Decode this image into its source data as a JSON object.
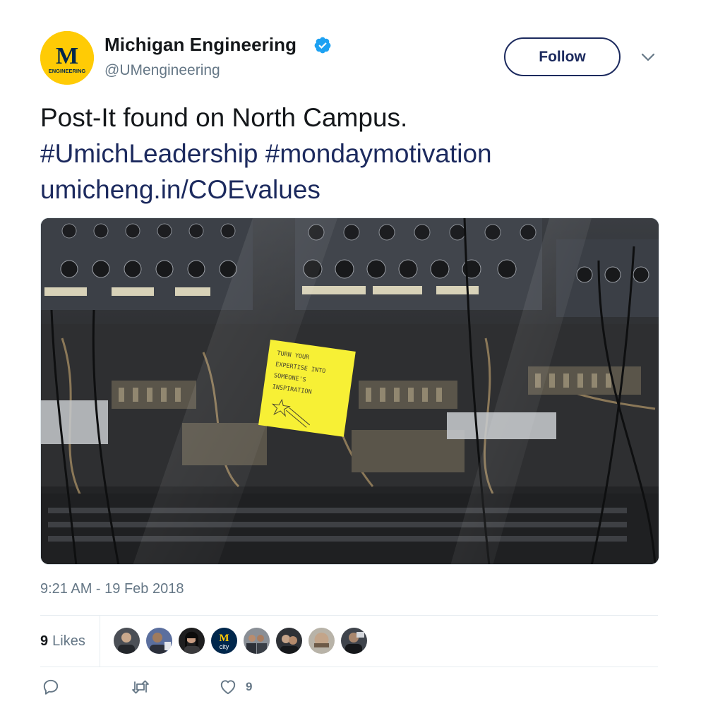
{
  "account": {
    "name": "Michigan Engineering",
    "handle": "@UMengineering",
    "avatar_letter": "M",
    "avatar_caption": "ENGINEERING",
    "verified": true,
    "avatar_bg": "#ffcb05",
    "avatar_fg": "#00274c"
  },
  "header": {
    "follow_label": "Follow",
    "menu_icon": "chevron-down-icon"
  },
  "tweet": {
    "text": "Post-It found on North Campus.",
    "hashtags": "#UmichLeadership #mondaymotivation",
    "link": "umicheng.in/COEvalues"
  },
  "photo": {
    "description_icon": "photo",
    "sticky_note_lines": [
      "TURN YOUR",
      "EXPERTISE INTO",
      "SOMEONE'S",
      "INSPIRATION"
    ]
  },
  "meta": {
    "timestamp": "9:21 AM - 19 Feb 2018"
  },
  "stats": {
    "likes_count": "9",
    "likes_label": "Likes",
    "liker_avatars": [
      "liker-1",
      "liker-2",
      "liker-3",
      "liker-4-mcity",
      "liker-5",
      "liker-6",
      "liker-7",
      "liker-8"
    ],
    "mcity_letter": "M",
    "mcity_text": "city"
  },
  "actions": {
    "reply_icon": "reply-icon",
    "retweet_icon": "retweet-icon",
    "like_icon": "heart-icon",
    "like_count": "9"
  },
  "colors": {
    "link": "#1c2a5e",
    "secondary_text": "#657786",
    "verified_blue": "#1da1f2",
    "sticky_note": "#f7f035"
  }
}
